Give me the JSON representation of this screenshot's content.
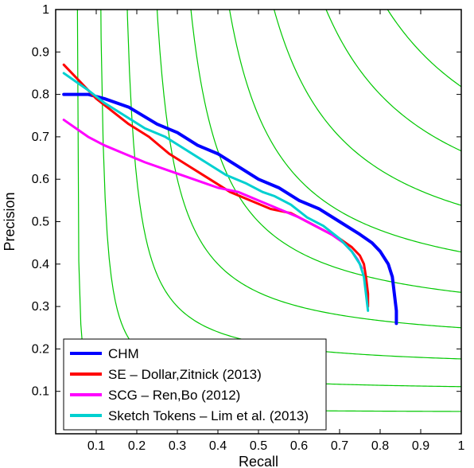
{
  "chart_data": {
    "type": "line",
    "title": "",
    "xlabel": "Recall",
    "ylabel": "Precision",
    "xlim": [
      0,
      1
    ],
    "ylim": [
      0,
      1
    ],
    "xticks": [
      0.1,
      0.2,
      0.3,
      0.4,
      0.5,
      0.6,
      0.7,
      0.8,
      0.9,
      1
    ],
    "yticks": [
      0.1,
      0.2,
      0.3,
      0.4,
      0.5,
      0.6,
      0.7,
      0.8,
      0.9,
      1
    ],
    "iso_f_values": [
      0.1,
      0.2,
      0.3,
      0.4,
      0.5,
      0.6,
      0.7,
      0.8,
      0.9
    ],
    "series": [
      {
        "name": "CHM",
        "color": "#0000ff",
        "width": 4,
        "points": [
          [
            0.02,
            0.8
          ],
          [
            0.05,
            0.8
          ],
          [
            0.08,
            0.8
          ],
          [
            0.12,
            0.79
          ],
          [
            0.18,
            0.77
          ],
          [
            0.25,
            0.73
          ],
          [
            0.3,
            0.71
          ],
          [
            0.35,
            0.68
          ],
          [
            0.4,
            0.66
          ],
          [
            0.45,
            0.63
          ],
          [
            0.5,
            0.6
          ],
          [
            0.55,
            0.58
          ],
          [
            0.6,
            0.55
          ],
          [
            0.65,
            0.53
          ],
          [
            0.7,
            0.5
          ],
          [
            0.75,
            0.47
          ],
          [
            0.78,
            0.45
          ],
          [
            0.8,
            0.43
          ],
          [
            0.82,
            0.4
          ],
          [
            0.83,
            0.37
          ],
          [
            0.835,
            0.33
          ],
          [
            0.84,
            0.29
          ],
          [
            0.84,
            0.26
          ]
        ]
      },
      {
        "name": "SE – Dollar,Zitnick (2013)",
        "color": "#ff0000",
        "width": 3,
        "points": [
          [
            0.02,
            0.87
          ],
          [
            0.04,
            0.85
          ],
          [
            0.07,
            0.82
          ],
          [
            0.1,
            0.79
          ],
          [
            0.14,
            0.76
          ],
          [
            0.18,
            0.73
          ],
          [
            0.23,
            0.7
          ],
          [
            0.28,
            0.66
          ],
          [
            0.33,
            0.63
          ],
          [
            0.38,
            0.6
          ],
          [
            0.43,
            0.57
          ],
          [
            0.48,
            0.55
          ],
          [
            0.53,
            0.53
          ],
          [
            0.58,
            0.52
          ],
          [
            0.62,
            0.5
          ],
          [
            0.66,
            0.48
          ],
          [
            0.7,
            0.46
          ],
          [
            0.73,
            0.44
          ],
          [
            0.75,
            0.42
          ],
          [
            0.76,
            0.4
          ],
          [
            0.765,
            0.37
          ],
          [
            0.77,
            0.33
          ],
          [
            0.77,
            0.3
          ]
        ]
      },
      {
        "name": "SCG – Ren,Bo (2012)",
        "color": "#ff00ff",
        "width": 3,
        "points": [
          [
            0.02,
            0.74
          ],
          [
            0.05,
            0.72
          ],
          [
            0.08,
            0.7
          ],
          [
            0.12,
            0.68
          ],
          [
            0.17,
            0.66
          ],
          [
            0.22,
            0.64
          ],
          [
            0.28,
            0.62
          ],
          [
            0.34,
            0.6
          ],
          [
            0.4,
            0.58
          ],
          [
            0.45,
            0.57
          ],
          [
            0.5,
            0.55
          ],
          [
            0.55,
            0.53
          ],
          [
            0.6,
            0.51
          ],
          [
            0.64,
            0.49
          ],
          [
            0.68,
            0.47
          ],
          [
            0.71,
            0.45
          ],
          [
            0.73,
            0.43
          ],
          [
            0.745,
            0.41
          ],
          [
            0.755,
            0.39
          ]
        ]
      },
      {
        "name": "Sketch Tokens – Lim et al. (2013)",
        "color": "#00d0d0",
        "width": 3,
        "points": [
          [
            0.02,
            0.85
          ],
          [
            0.05,
            0.83
          ],
          [
            0.08,
            0.81
          ],
          [
            0.12,
            0.78
          ],
          [
            0.17,
            0.75
          ],
          [
            0.22,
            0.72
          ],
          [
            0.27,
            0.7
          ],
          [
            0.32,
            0.67
          ],
          [
            0.37,
            0.64
          ],
          [
            0.42,
            0.61
          ],
          [
            0.47,
            0.59
          ],
          [
            0.51,
            0.57
          ],
          [
            0.54,
            0.56
          ],
          [
            0.58,
            0.54
          ],
          [
            0.62,
            0.51
          ],
          [
            0.66,
            0.49
          ],
          [
            0.7,
            0.46
          ],
          [
            0.73,
            0.43
          ],
          [
            0.75,
            0.4
          ],
          [
            0.76,
            0.37
          ],
          [
            0.765,
            0.33
          ],
          [
            0.77,
            0.29
          ]
        ]
      }
    ],
    "legend": {
      "position": "lower-left",
      "entries": [
        {
          "label": "CHM",
          "color": "#0000ff"
        },
        {
          "label": "SE – Dollar,Zitnick (2013)",
          "color": "#ff0000"
        },
        {
          "label": "SCG – Ren,Bo (2012)",
          "color": "#ff00ff"
        },
        {
          "label": "Sketch Tokens – Lim et al. (2013)",
          "color": "#00d0d0"
        }
      ]
    }
  }
}
